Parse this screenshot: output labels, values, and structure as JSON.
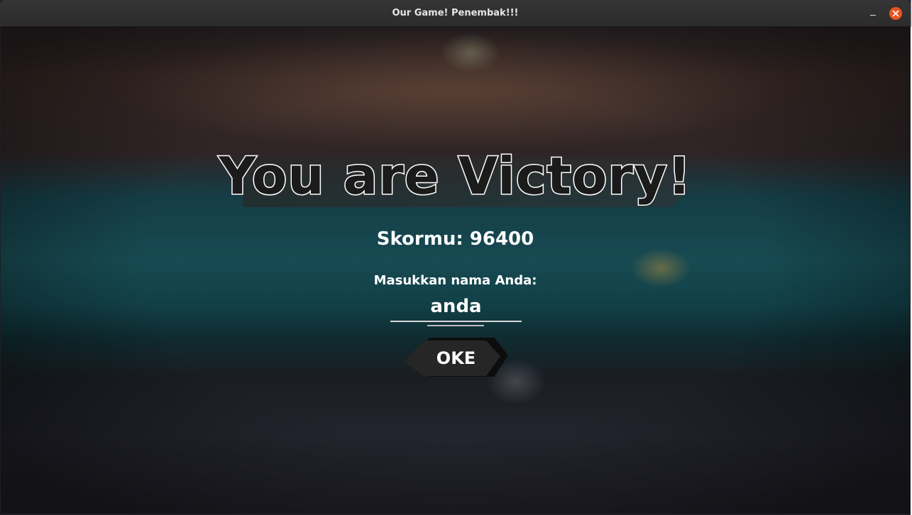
{
  "window": {
    "title": "Our Game! Penembak!!!",
    "minimize_symbol": "_",
    "close_icon": "close-icon",
    "close_color": "#e95420"
  },
  "game": {
    "result_title": "You are Victory!",
    "score_text": "Skormu: 96400",
    "name_prompt": "Masukkan nama Anda:",
    "name_value": "anda",
    "ok_label": "OKE"
  }
}
